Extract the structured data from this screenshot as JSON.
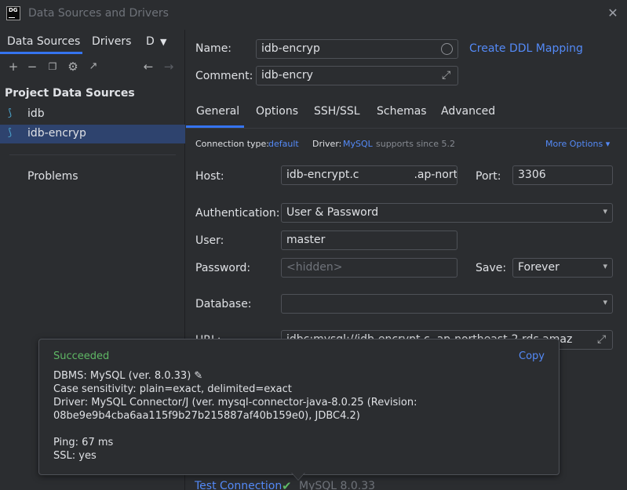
{
  "window": {
    "title": "Data Sources and Drivers",
    "logo_text": "DG"
  },
  "left": {
    "tabs": [
      "Data Sources",
      "Drivers",
      "D"
    ],
    "section_title": "Project Data Sources",
    "items": [
      {
        "label": "idb",
        "selected": false
      },
      {
        "label": "idb-encryp",
        "selected": true
      }
    ],
    "problems_label": "Problems"
  },
  "form": {
    "name_label": "Name:",
    "name_value": "idb-encryp",
    "create_ddl_link": "Create DDL Mapping",
    "comment_label": "Comment:",
    "comment_value": "idb-encry",
    "tabs": [
      "General",
      "Options",
      "SSH/SSL",
      "Schemas",
      "Advanced"
    ],
    "active_tab": "General",
    "connection_type_label": "Connection type:",
    "connection_type_value": "default",
    "driver_label": "Driver:",
    "driver_value": "MySQL",
    "driver_note": "supports since 5.2",
    "more_options": "More Options",
    "host_label": "Host:",
    "host_value_start": "idb-encrypt.c",
    "host_value_end": ".ap-north",
    "port_label": "Port:",
    "port_value": "3306",
    "auth_label": "Authentication:",
    "auth_value": "User & Password",
    "user_label": "User:",
    "user_value": "master",
    "password_label": "Password:",
    "password_placeholder": "<hidden>",
    "save_label": "Save:",
    "save_value": "Forever",
    "database_label": "Database:",
    "database_value": "",
    "url_label": "URL:",
    "url_value": "jdbc:mysql://idb-encrypt.c              .ap-northeast-2.rds.amaz"
  },
  "popup": {
    "status": "Succeeded",
    "copy_label": "Copy",
    "lines": [
      "DBMS: MySQL (ver. 8.0.33)",
      "Case sensitivity: plain=exact, delimited=exact",
      "Driver: MySQL Connector/J (ver. mysql-connector-java-8.0.25 (Revision:",
      "08be9e9b4cba6aa115f9b27b215887af40b159e0), JDBC4.2)",
      "Ping: 67 ms",
      "SSL: yes"
    ]
  },
  "footer": {
    "test_connection": "Test Connection",
    "version_text": "MySQL 8.0.33"
  },
  "colors": {
    "accent": "#3574f0",
    "link": "#548af7",
    "success": "#5fb865",
    "background": "#2b2d30"
  }
}
